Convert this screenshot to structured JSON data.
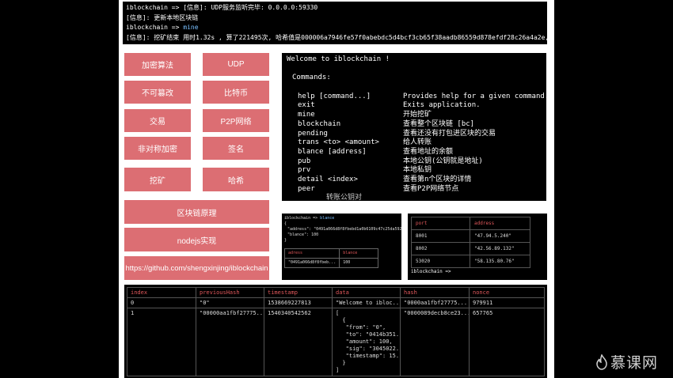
{
  "top_terminal": {
    "lines": [
      "iblockchain => [信息]: UDP服务监听完毕: 0.0.0.0:59330",
      "[信息]: 更新本地区块链"
    ],
    "prompt": "iblockchain =>",
    "command": "mine",
    "result": "[信息]: 挖矿结束 用时1.32s , 算了221495次, 哈希值是000006a7946fe57f0abebdc5d4bcf3cb65f38aadb86559d878efdf28c26a4a2e, 入账100 请笑纳"
  },
  "buttons": {
    "crypto": "加密算法",
    "udp": "UDP",
    "tamper": "不可篡改",
    "bitcoin": "比特币",
    "trade": "交易",
    "p2p": "P2P网络",
    "asym": "非对称加密",
    "sign": "签名",
    "mine": "挖矿",
    "hash": "哈希",
    "principle": "区块链原理",
    "nodejs": "nodejs实现",
    "github": "https://github.com/shengxinjing/iblockchain"
  },
  "help_terminal": {
    "welcome": "Welcome to iblockchain !",
    "commands_title": "Commands:",
    "commands": [
      {
        "cmd": "help [command...]",
        "desc": "Provides help for a given command."
      },
      {
        "cmd": "exit",
        "desc": "Exits application."
      },
      {
        "cmd": "mine",
        "desc": "开始挖矿"
      },
      {
        "cmd": "blockchain",
        "desc": "查看整个区块链 [bc]"
      },
      {
        "cmd": "pending",
        "desc": "查看还没有打包进区块的交易"
      },
      {
        "cmd": "trans <to> <amount>",
        "desc": "给人转账"
      },
      {
        "cmd": "blance [address]",
        "desc": "查看地址的余额"
      },
      {
        "cmd": "pub",
        "desc": "本地公钥(公钥就是地址)"
      },
      {
        "cmd": "prv",
        "desc": "本地私钥"
      },
      {
        "cmd": "detail <index>",
        "desc": "查看第n个区块的详情"
      },
      {
        "cmd": "peer",
        "desc": "查看P2P网络节点"
      }
    ],
    "cut_text": "转账公钥对"
  },
  "mini_terminal": {
    "prompt": "iblockchain =>",
    "command": "blance",
    "json_open": "{",
    "address_line": "\"address\": \"0491a066d8f8fbebd1a0b6109c47c25da5927ca9e3",
    "balance_line": "\"blance\": 100",
    "json_close": "}",
    "table_headers": [
      "adress",
      "blance"
    ],
    "table_row": [
      "\"0491a066d8f8fbeb...",
      "100"
    ]
  },
  "peers_table": {
    "headers": [
      "port",
      "address"
    ],
    "rows": [
      [
        "8001",
        "\"47.94.5.240\""
      ],
      [
        "8002",
        "\"42.56.89.132\""
      ],
      [
        "53020",
        "\"58.135.80.76\""
      ]
    ],
    "bottom_prompt": "iblockchain =>"
  },
  "chain_table": {
    "headers": [
      "index",
      "previousHash",
      "timestamp",
      "data",
      "hash",
      "nonce"
    ],
    "rows": [
      {
        "index": "0",
        "previousHash": "\"0\"",
        "timestamp": "1538669227813",
        "data": "\"Welcome to ibloc...",
        "hash": "\"0000aa1fbf27775...",
        "nonce": "979911"
      },
      {
        "index": "1",
        "previousHash": "\"00000aa1fbf27775...",
        "timestamp": "1540340542562",
        "data": "[\n  {\n   \"from\": \"0\",\n   \"to\": \"0414b351...\n   \"amount\": 100,\n   \"sig\": \"3045022...\n   \"timestamp\": 15...\n  }\n]",
        "hash": "\"0000089decb8ce23...",
        "nonce": "657765"
      }
    ]
  },
  "logo": {
    "text": "慕课网"
  },
  "colors": {
    "button": "#dc6e73",
    "terminal_bg": "#000000",
    "accent_red": "#e0585b",
    "blue": "#79c0ff"
  }
}
